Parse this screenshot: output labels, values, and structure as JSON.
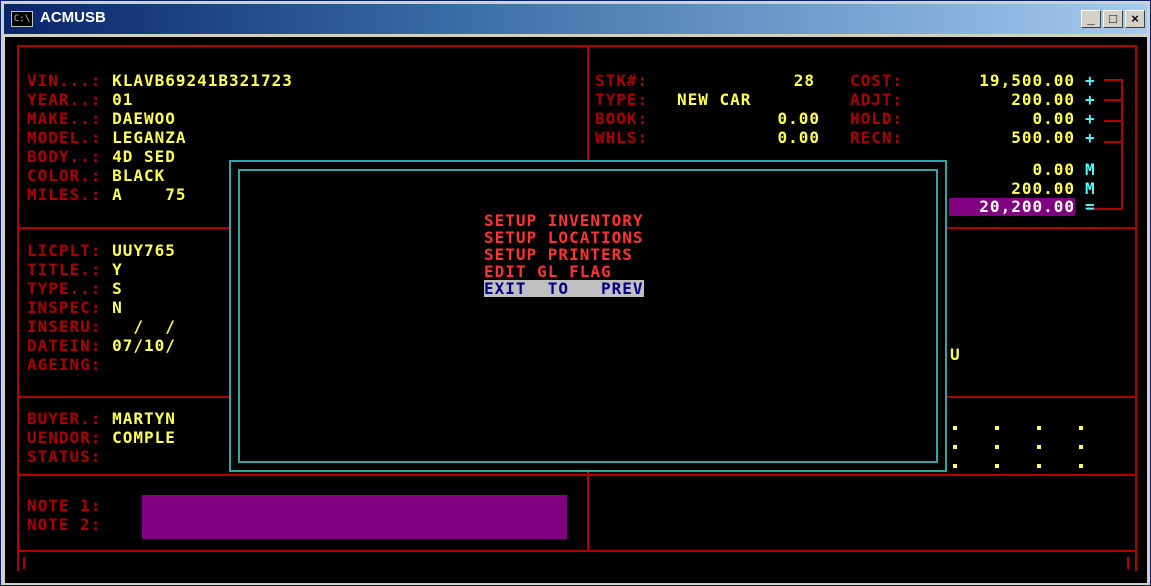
{
  "window": {
    "title": "ACMUSB",
    "icon_text": "C:\\",
    "min": "_",
    "max": "□",
    "close": "×"
  },
  "vehicle": [
    {
      "label": "VIN...:",
      "value": "KLAVB69241B321723"
    },
    {
      "label": "YEAR..:",
      "value": "01"
    },
    {
      "label": "MAKE..:",
      "value": "DAEWOO"
    },
    {
      "label": "MODEL.:",
      "value": "LEGANZA"
    },
    {
      "label": "BODY..:",
      "value": "4D SED"
    },
    {
      "label": "COLOR.:",
      "value": "BLACK"
    },
    {
      "label": "MILES.:",
      "value": "A    75"
    }
  ],
  "registration": [
    {
      "label": "LICPLT:",
      "value": "UUY765"
    },
    {
      "label": "TITLE.:",
      "value": "Y"
    },
    {
      "label": "TYPE..:",
      "value": "S"
    },
    {
      "label": "INSPEC:",
      "value": "N"
    },
    {
      "label": "INSERU:",
      "value": "  /  /"
    },
    {
      "label": "DATEIN:",
      "value": "07/10/"
    },
    {
      "label": "AGEING:",
      "value": ""
    }
  ],
  "parties": [
    {
      "label": "BUYER.:",
      "value": "MARTYN"
    },
    {
      "label": "UENDOR:",
      "value": "COMPLE"
    },
    {
      "label": "STATUS:",
      "value": ""
    }
  ],
  "notes": [
    {
      "label": "NOTE 1:"
    },
    {
      "label": "NOTE 2:"
    }
  ],
  "stock": [
    {
      "label": "STK#:",
      "value": "28"
    },
    {
      "label": "TYPE:",
      "value": "NEW CAR"
    },
    {
      "label": "BOOK:",
      "value": "0.00"
    },
    {
      "label": "WHLS:",
      "value": "0.00"
    }
  ],
  "costs": [
    {
      "label": "COST:",
      "value": "19,500.00",
      "op": "+"
    },
    {
      "label": "ADJT:",
      "value": "200.00",
      "op": "+"
    },
    {
      "label": "HOLD:",
      "value": "0.00",
      "op": "+"
    },
    {
      "label": "RECN:",
      "value": "500.00",
      "op": "+"
    },
    {
      "label": "",
      "value": "0.00",
      "op": "M"
    },
    {
      "label": "",
      "value": "200.00",
      "op": "M"
    },
    {
      "label": "",
      "value": "20,200.00",
      "op": "="
    }
  ],
  "right_misc": {
    "dateinfo_tail": "U"
  },
  "menu": {
    "items": [
      "SETUP INVENTORY",
      "SETUP LOCATIONS",
      "SETUP PRINTERS",
      "EDIT GL FLAG",
      "EXIT  TO   PREV"
    ],
    "selected_index": 4
  }
}
